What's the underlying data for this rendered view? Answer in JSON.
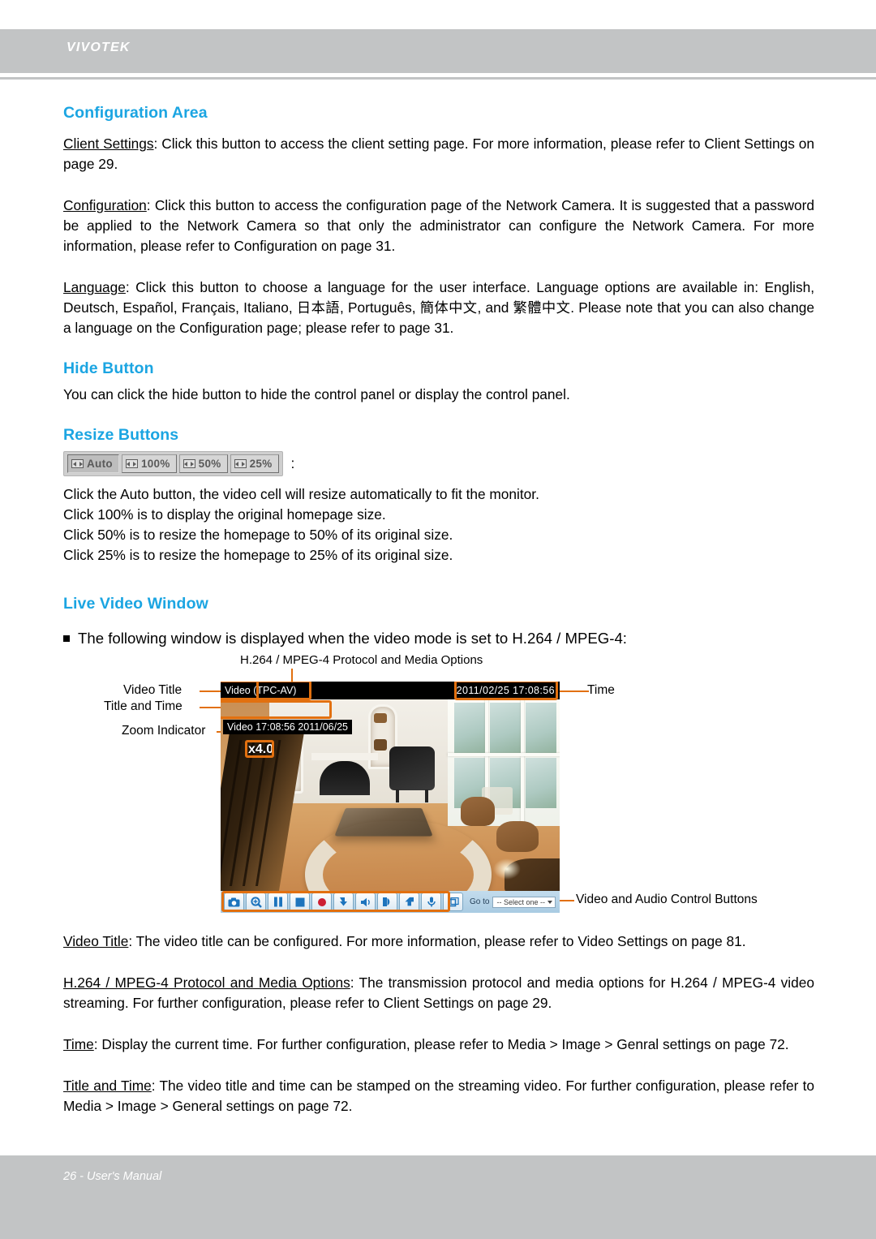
{
  "header": {
    "brand": "VIVOTEK"
  },
  "footer": {
    "text": "26 - User's Manual"
  },
  "sections": {
    "configuration_area": {
      "heading": "Configuration Area",
      "client_settings": {
        "term": "Client Settings",
        "body": ": Click this button to access the client setting page. For more information, please refer to Client Settings on page 29."
      },
      "configuration": {
        "term": "Configuration",
        "body": ": Click this button to access the configuration page of the Network Camera. It is suggested that a password be applied to the Network Camera so that only the administrator can configure the Network Camera. For more information, please refer to Configuration on page 31."
      },
      "language": {
        "term": "Language",
        "body": ": Click this button to choose a language for the user interface. Language options are available in: English, Deutsch, Español, Français, Italiano, 日本語, Português, 簡体中文, and 繁體中文.  Please note that you can also change a language on the Configuration page; please refer to page 31."
      }
    },
    "hide_button": {
      "heading": "Hide Button",
      "body": "You can click the hide button to hide the control panel or display the control panel."
    },
    "resize_buttons": {
      "heading": "Resize Buttons",
      "buttons": [
        "Auto",
        "100%",
        "50%",
        "25%"
      ],
      "colon": ":",
      "lines": [
        "Click the Auto button, the video cell will resize automatically to fit the monitor.",
        "Click 100% is to display the original homepage size.",
        "Click 50% is to resize the homepage to 50% of its original size.",
        "Click 25% is to resize the homepage to 25% of its original size."
      ]
    },
    "live_video_window": {
      "heading": "Live Video Window",
      "bullet": "The following window is displayed when the video mode is set to H.264 / MPEG-4:"
    }
  },
  "figure": {
    "caption_top": "H.264 / MPEG-4 Protocol and Media Options",
    "callouts": {
      "video_title": "Video Title",
      "title_and_time": "Title and Time",
      "zoom_indicator": "Zoom Indicator",
      "time": "Time",
      "controls": "Video and Audio Control Buttons"
    },
    "video": {
      "title_bar_title": "Video",
      "title_bar_protocol": "(TPC-AV)",
      "title_bar_timestamp": "2011/02/25  17:08:56",
      "overlay_title_time": "Video 17:08:56  2011/06/25",
      "zoom_indicator": "x4.0",
      "goto_label": "Go to",
      "goto_selected": "-- Select one --",
      "control_buttons": [
        "snapshot-icon",
        "digital-zoom-icon",
        "pause-icon",
        "stop-icon",
        "record-icon",
        "save-video-icon",
        "volume-icon",
        "talk-icon",
        "receive-audio-icon",
        "microphone-icon",
        "full-screen-icon"
      ]
    },
    "accent_color": "#e2700f"
  },
  "descriptions": {
    "video_title": {
      "term": "Video Title",
      "body": ": The video title can be configured. For more information, please refer to Video Settings on page 81."
    },
    "protocol": {
      "term": "H.264 / MPEG-4 Protocol and Media Options",
      "body": ": The transmission protocol and media options for H.264 / MPEG-4 video streaming. For further configuration, please refer to Client Settings on page 29."
    },
    "time": {
      "term": "Time",
      "body": ": Display the current time. For further configuration, please refer to Media > Image > Genral settings on page 72."
    },
    "title_and_time": {
      "term": "Title and Time",
      "body": ": The video title and time can be stamped on the streaming video. For further configuration, please refer to Media > Image > General settings on page 72."
    }
  }
}
